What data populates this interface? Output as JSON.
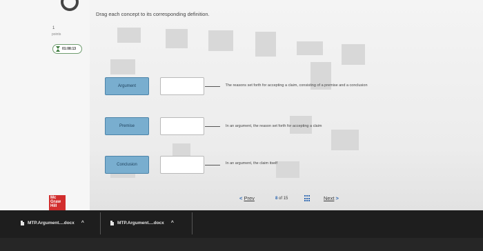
{
  "question": {
    "points_value": "1",
    "points_label": "points",
    "timer": "01:08:13",
    "instructions": "Drag each concept to its corresponding definition."
  },
  "terms": [
    {
      "label": "Argument"
    },
    {
      "label": "Premise"
    },
    {
      "label": "Conclusion"
    }
  ],
  "definitions": [
    {
      "text": "The reasons set forth for accepting a claim, consisting of a premise and a conclusion"
    },
    {
      "text": "In an argument, the reason set forth for accepting a claim"
    },
    {
      "text": "In an argument, the claim itself"
    }
  ],
  "navigation": {
    "prev_label": "Prev",
    "next_label": "Next",
    "current_page": "8",
    "of_label": "of",
    "total_pages": "15"
  },
  "logo": {
    "text": "Mc Graw Hill"
  },
  "downloads": [
    {
      "name": "MTP.Argument....docx"
    },
    {
      "name": "MTP.Argument....docx"
    }
  ],
  "colors": {
    "term_button": "#79aecf",
    "accent": "#2b66b1",
    "timer_border": "#6e9c6e",
    "logo": "#d22d2d"
  }
}
